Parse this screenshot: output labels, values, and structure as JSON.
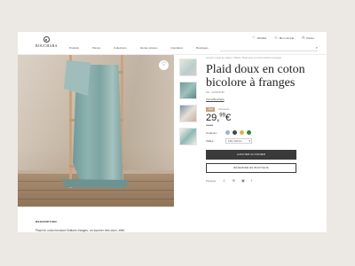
{
  "header": {
    "logo_text": "BOUCHARA",
    "nav": [
      "Produits",
      "Pièces",
      "Collections",
      "Ventes privées",
      "Inspiration",
      "Boutiques"
    ],
    "utils": [
      {
        "icon": "heart-icon",
        "glyph": "♡",
        "label": "Wishlist"
      },
      {
        "icon": "user-icon",
        "glyph": "⚇",
        "label": "Mon compte"
      },
      {
        "icon": "bag-icon",
        "glyph": "⊓",
        "label": "Panier"
      }
    ],
    "search_icon": "⌕"
  },
  "hero": {
    "favorite_glyph": "♡"
  },
  "product": {
    "breadcrumb": "Accueil / Linge de maison / Plaids / Plaid doux en coton bicolore à franges",
    "title": "Plaid doux en coton bicolore à franges",
    "ref": "Réf : 1003456789",
    "brand_link": "Voir la Bouchara",
    "badge": "-30%",
    "badge_note": "Nouveauté",
    "price_main": "29,",
    "price_cents": "99",
    "price_currency": "€",
    "old_price": "42,99€",
    "color_label": "Couleurs :",
    "colors": [
      "#9db4c8",
      "#3a4a5c",
      "#d9b93a",
      "#2f8a3a"
    ],
    "size_label": "Tailles :",
    "size_value": "130 x 160 cm",
    "add_to_cart": "AJOUTER AU PANIER",
    "store_button": "RÉSERVER EN BOUTIQUE",
    "share_label": "Partager",
    "share_icons": [
      "☺",
      "✉",
      "▣",
      "f"
    ]
  },
  "description": {
    "title": "DESCRIPTION",
    "text": "Plaid en coton bicolore finitions franges, un toucher très doux, effet"
  }
}
